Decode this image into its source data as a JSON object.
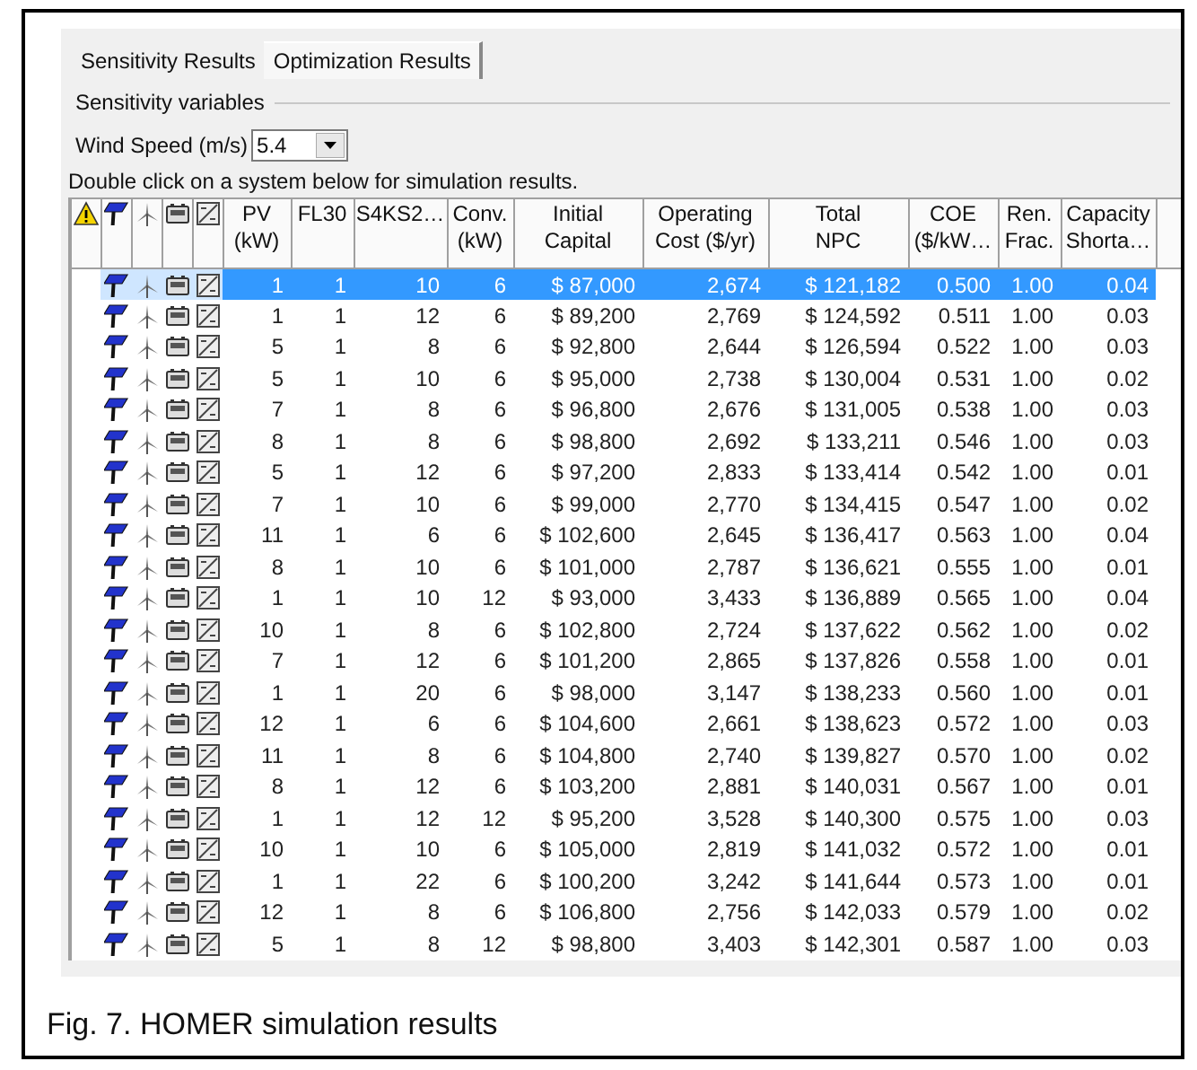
{
  "tabs": [
    {
      "label": "Sensitivity Results",
      "selected": false
    },
    {
      "label": "Optimization Results",
      "selected": true
    }
  ],
  "section_label": "Sensitivity variables",
  "wind_speed": {
    "label": "Wind Speed (m/s)",
    "value": "5.4"
  },
  "hint": "Double click on a system below for simulation results.",
  "table": {
    "columns": [
      "PV\n(kW)",
      "FL30",
      "S4KS2…",
      "Conv.\n(kW)",
      "Initial\nCapital",
      "Operating\nCost ($/yr)",
      "Total\nNPC",
      "COE\n($/kW…",
      "Ren.\nFrac.",
      "Capacity\nShorta…"
    ],
    "rows": [
      {
        "selected": true,
        "cells": [
          "1",
          "1",
          "10",
          "6",
          "$ 87,000",
          "2,674",
          "$ 121,182",
          "0.500",
          "1.00",
          "0.04"
        ]
      },
      {
        "selected": false,
        "cells": [
          "1",
          "1",
          "12",
          "6",
          "$ 89,200",
          "2,769",
          "$ 124,592",
          "0.511",
          "1.00",
          "0.03"
        ]
      },
      {
        "selected": false,
        "cells": [
          "5",
          "1",
          "8",
          "6",
          "$ 92,800",
          "2,644",
          "$ 126,594",
          "0.522",
          "1.00",
          "0.03"
        ]
      },
      {
        "selected": false,
        "cells": [
          "5",
          "1",
          "10",
          "6",
          "$ 95,000",
          "2,738",
          "$ 130,004",
          "0.531",
          "1.00",
          "0.02"
        ]
      },
      {
        "selected": false,
        "cells": [
          "7",
          "1",
          "8",
          "6",
          "$ 96,800",
          "2,676",
          "$ 131,005",
          "0.538",
          "1.00",
          "0.03"
        ]
      },
      {
        "selected": false,
        "cells": [
          "8",
          "1",
          "8",
          "6",
          "$ 98,800",
          "2,692",
          "$ 133,211",
          "0.546",
          "1.00",
          "0.03"
        ]
      },
      {
        "selected": false,
        "cells": [
          "5",
          "1",
          "12",
          "6",
          "$ 97,200",
          "2,833",
          "$ 133,414",
          "0.542",
          "1.00",
          "0.01"
        ]
      },
      {
        "selected": false,
        "cells": [
          "7",
          "1",
          "10",
          "6",
          "$ 99,000",
          "2,770",
          "$ 134,415",
          "0.547",
          "1.00",
          "0.02"
        ]
      },
      {
        "selected": false,
        "cells": [
          "11",
          "1",
          "6",
          "6",
          "$ 102,600",
          "2,645",
          "$ 136,417",
          "0.563",
          "1.00",
          "0.04"
        ]
      },
      {
        "selected": false,
        "cells": [
          "8",
          "1",
          "10",
          "6",
          "$ 101,000",
          "2,787",
          "$ 136,621",
          "0.555",
          "1.00",
          "0.01"
        ]
      },
      {
        "selected": false,
        "cells": [
          "1",
          "1",
          "10",
          "12",
          "$ 93,000",
          "3,433",
          "$ 136,889",
          "0.565",
          "1.00",
          "0.04"
        ]
      },
      {
        "selected": false,
        "cells": [
          "10",
          "1",
          "8",
          "6",
          "$ 102,800",
          "2,724",
          "$ 137,622",
          "0.562",
          "1.00",
          "0.02"
        ]
      },
      {
        "selected": false,
        "cells": [
          "7",
          "1",
          "12",
          "6",
          "$ 101,200",
          "2,865",
          "$ 137,826",
          "0.558",
          "1.00",
          "0.01"
        ]
      },
      {
        "selected": false,
        "cells": [
          "1",
          "1",
          "20",
          "6",
          "$ 98,000",
          "3,147",
          "$ 138,233",
          "0.560",
          "1.00",
          "0.01"
        ]
      },
      {
        "selected": false,
        "cells": [
          "12",
          "1",
          "6",
          "6",
          "$ 104,600",
          "2,661",
          "$ 138,623",
          "0.572",
          "1.00",
          "0.03"
        ]
      },
      {
        "selected": false,
        "cells": [
          "11",
          "1",
          "8",
          "6",
          "$ 104,800",
          "2,740",
          "$ 139,827",
          "0.570",
          "1.00",
          "0.02"
        ]
      },
      {
        "selected": false,
        "cells": [
          "8",
          "1",
          "12",
          "6",
          "$ 103,200",
          "2,881",
          "$ 140,031",
          "0.567",
          "1.00",
          "0.01"
        ]
      },
      {
        "selected": false,
        "cells": [
          "1",
          "1",
          "12",
          "12",
          "$ 95,200",
          "3,528",
          "$ 140,300",
          "0.575",
          "1.00",
          "0.03"
        ]
      },
      {
        "selected": false,
        "cells": [
          "10",
          "1",
          "10",
          "6",
          "$ 105,000",
          "2,819",
          "$ 141,032",
          "0.572",
          "1.00",
          "0.01"
        ]
      },
      {
        "selected": false,
        "cells": [
          "1",
          "1",
          "22",
          "6",
          "$ 100,200",
          "3,242",
          "$ 141,644",
          "0.573",
          "1.00",
          "0.01"
        ]
      },
      {
        "selected": false,
        "cells": [
          "12",
          "1",
          "8",
          "6",
          "$ 106,800",
          "2,756",
          "$ 142,033",
          "0.579",
          "1.00",
          "0.02"
        ]
      },
      {
        "selected": false,
        "cells": [
          "5",
          "1",
          "8",
          "12",
          "$ 98,800",
          "3,403",
          "$ 142,301",
          "0.587",
          "1.00",
          "0.03"
        ]
      }
    ]
  },
  "caption": "Fig. 7. HOMER simulation results"
}
